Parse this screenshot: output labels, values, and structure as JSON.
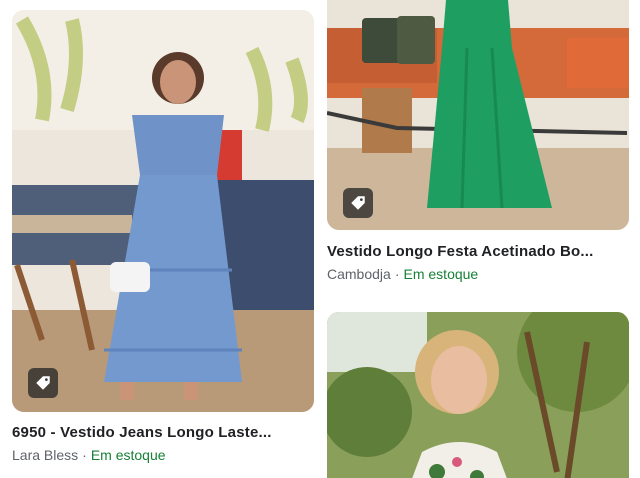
{
  "results": [
    {
      "title": "6950 - Vestido Jeans Longo Laste...",
      "source": "Lara Bless",
      "separator": "·",
      "availability": "Em estoque",
      "badge_icon": "tag-icon"
    },
    {
      "title": "Vestido Longo Festa Acetinado Bo...",
      "source": "Cambodja",
      "separator": "·",
      "availability": "Em estoque",
      "badge_icon": "tag-icon"
    },
    {
      "title": "",
      "source": "",
      "availability": ""
    }
  ],
  "colors": {
    "availability": "#188038",
    "source": "#5f6368",
    "title": "#202124",
    "badge_bg": "#282828"
  }
}
